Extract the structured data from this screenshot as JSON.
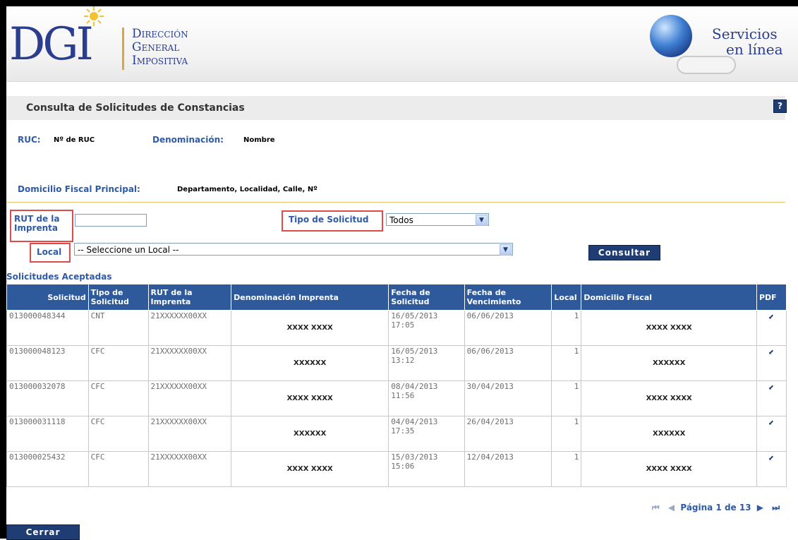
{
  "header": {
    "logo": "DGI",
    "logo_text_1": "Dirección",
    "logo_text_2": "General",
    "logo_text_3": "Impositiva",
    "servicios_1": "Servicios",
    "servicios_2": "en línea"
  },
  "page": {
    "title": "Consulta de Solicitudes de Constancias",
    "help": "?"
  },
  "info": {
    "ruc_label": "RUC:",
    "ruc_value": "Nº de RUC",
    "denom_label": "Denominación:",
    "denom_value": "Nombre",
    "domicilio_label": "Domicilio Fiscal Principal:",
    "domicilio_value": "Departamento, Localidad, Calle, Nº"
  },
  "filters": {
    "rut_label_1": "RUT de la",
    "rut_label_2": "Imprenta",
    "rut_value": "",
    "tipo_label": "Tipo de Solicitud",
    "tipo_value": "Todos",
    "local_label": "Local",
    "local_value": "-- Seleccione un Local --",
    "consultar": "Consultar"
  },
  "results": {
    "section_title": "Solicitudes Aceptadas",
    "columns": [
      "Solicitud",
      "Tipo de Solicitud",
      "RUT de la Imprenta",
      "Denominación Imprenta",
      "Fecha de Solicitud",
      "Fecha de Vencimiento",
      "Local",
      "Domicilio Fiscal",
      "PDF"
    ],
    "rows": [
      {
        "solicitud": "013000048344",
        "tipo": "CNT",
        "rut": "21XXXXXX00XX",
        "denom": "XXXX XXXX",
        "fecha_sol": "16/05/2013 17:05",
        "fecha_venc": "06/06/2013",
        "local": "1",
        "domicilio": "XXXX XXXX"
      },
      {
        "solicitud": "013000048123",
        "tipo": "CFC",
        "rut": "21XXXXXX00XX",
        "denom": "XXXXXX",
        "fecha_sol": "16/05/2013 13:12",
        "fecha_venc": "06/06/2013",
        "local": "1",
        "domicilio": "XXXXXX"
      },
      {
        "solicitud": "013000032078",
        "tipo": "CFC",
        "rut": "21XXXXXX00XX",
        "denom": "XXXX XXXX",
        "fecha_sol": "08/04/2013 11:56",
        "fecha_venc": "30/04/2013",
        "local": "1",
        "domicilio": "XXXX XXXX"
      },
      {
        "solicitud": "013000031118",
        "tipo": "CFC",
        "rut": "21XXXXXX00XX",
        "denom": "XXXXXX",
        "fecha_sol": "04/04/2013 17:35",
        "fecha_venc": "26/04/2013",
        "local": "1",
        "domicilio": "XXXXXX"
      },
      {
        "solicitud": "013000025432",
        "tipo": "CFC",
        "rut": "21XXXXXX00XX",
        "denom": "XXXX XXXX",
        "fecha_sol": "15/03/2013 15:06",
        "fecha_venc": "12/04/2013",
        "local": "1",
        "domicilio": "XXXX XXXX"
      }
    ],
    "pager_text": "Página 1 de 13"
  },
  "footer": {
    "cerrar": "Cerrar"
  },
  "colors": {
    "header_blue": "#2e5a9c",
    "label_blue": "#2f5aa8",
    "button_navy": "#1f3d73",
    "highlight_red": "#e04a4a"
  }
}
